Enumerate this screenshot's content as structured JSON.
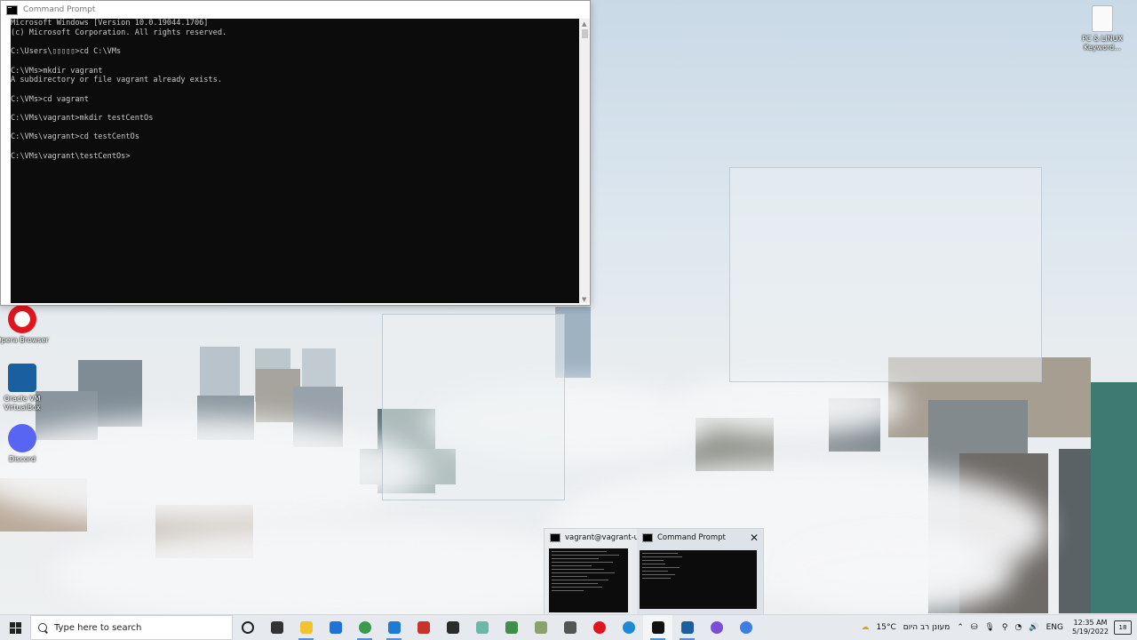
{
  "window": {
    "title": "Command Prompt",
    "lines": [
      "Microsoft Windows [Version 10.0.19044.1706]",
      "(c) Microsoft Corporation. All rights reserved.",
      "",
      "C:\\Users\\▯▯▯▯▯>cd C:\\VMs",
      "",
      "C:\\VMs>mkdir vagrant",
      "A subdirectory or file vagrant already exists.",
      "",
      "C:\\VMs>cd vagrant",
      "",
      "C:\\VMs\\vagrant>mkdir testCentOs",
      "",
      "C:\\VMs\\vagrant>cd testCentOs",
      "",
      "C:\\VMs\\vagrant\\testCentOs>"
    ]
  },
  "desktop_icons": [
    {
      "label": "Opera Browser",
      "icon": "opera-icon",
      "color": "#e0161e"
    },
    {
      "label": "Oracle VM VirtualBox",
      "icon": "virtualbox-icon",
      "color": "#1a5fa0"
    },
    {
      "label": "Discord",
      "icon": "discord-icon",
      "color": "#5865f2"
    },
    {
      "label": "PC & LINUX Keyword...",
      "icon": "document-icon",
      "color": "#ffffff"
    }
  ],
  "taskbar_preview": {
    "items": [
      {
        "title": "vagrant@vagrant-u..."
      },
      {
        "title": "Command Prompt"
      }
    ]
  },
  "taskbar": {
    "search_placeholder": "Type here to search",
    "apps": [
      {
        "name": "cortana-icon",
        "color": "#222222"
      },
      {
        "name": "task-view-icon",
        "color": "#333333"
      },
      {
        "name": "file-explorer-icon",
        "color": "#f2c230"
      },
      {
        "name": "mail-icon",
        "color": "#1e73d8"
      },
      {
        "name": "chrome-icon",
        "color": "#3a9b4a"
      },
      {
        "name": "vscode-icon",
        "color": "#1f7ad3"
      },
      {
        "name": "app-red-icon",
        "color": "#c8332c"
      },
      {
        "name": "app-terminal-icon",
        "color": "#2b2b2b"
      },
      {
        "name": "app-green-icon",
        "color": "#6bb8a8"
      },
      {
        "name": "app-map-icon",
        "color": "#3f8f4a"
      },
      {
        "name": "app-pen-icon",
        "color": "#8aa36a"
      },
      {
        "name": "calculator-icon",
        "color": "#555555"
      },
      {
        "name": "opera-icon",
        "color": "#e0161e"
      },
      {
        "name": "edge-icon",
        "color": "#1d8ad6"
      },
      {
        "name": "command-prompt-icon",
        "color": "#111111"
      },
      {
        "name": "virtualbox-icon",
        "color": "#1a5fa0"
      },
      {
        "name": "app-purple-icon",
        "color": "#7a4fd6"
      },
      {
        "name": "chrome-alt-icon",
        "color": "#3c7fe0"
      }
    ],
    "weather": "15°C",
    "weather_text": "מעונן רב היום",
    "language": "ENG",
    "time": "12:35 AM",
    "date": "5/19/2022",
    "notifications": "18"
  }
}
